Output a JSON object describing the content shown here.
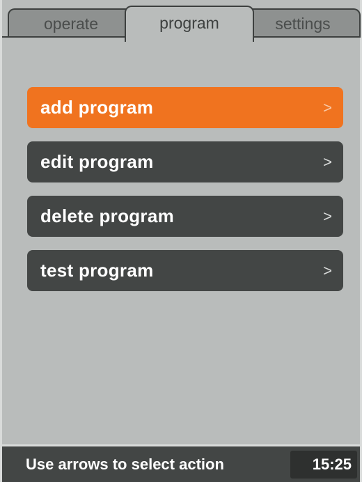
{
  "tabs": [
    {
      "label": "operate",
      "active": false
    },
    {
      "label": "program",
      "active": true
    },
    {
      "label": "settings",
      "active": false
    }
  ],
  "menu": {
    "items": [
      {
        "label": "add program",
        "arrow": ">",
        "selected": true
      },
      {
        "label": "edit program",
        "arrow": ">",
        "selected": false
      },
      {
        "label": "delete program",
        "arrow": ">",
        "selected": false
      },
      {
        "label": "test program",
        "arrow": ">",
        "selected": false
      }
    ]
  },
  "status": {
    "message": "Use arrows to select action",
    "time": "15:25"
  },
  "colors": {
    "background": "#b9bcbb",
    "selected": "#f0731f",
    "item": "#434645",
    "text": "#ffffff"
  },
  "icons": {
    "item_arrow": "chevron-right-icon"
  }
}
